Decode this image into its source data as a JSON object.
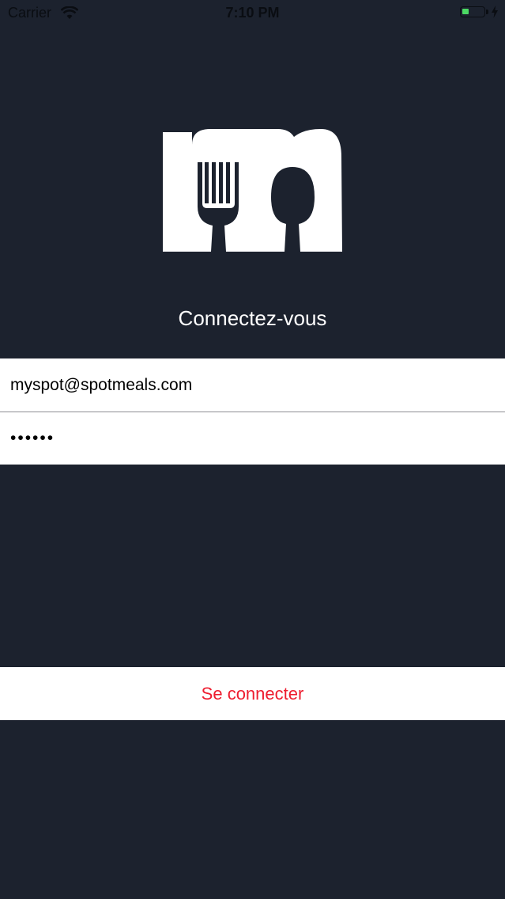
{
  "status_bar": {
    "carrier": "Carrier",
    "time": "7:10 PM",
    "battery_level": 0.3,
    "battery_charging": true,
    "battery_color": "#4cd964"
  },
  "logo": {
    "icon": "spotmeals-m-fork-spoon-logo"
  },
  "login": {
    "heading": "Connectez-vous",
    "email_value": "myspot@spotmeals.com",
    "password_value": "••••••",
    "submit_label": "Se connecter"
  },
  "colors": {
    "background": "#1c222e",
    "accent": "#ee1d2f",
    "field_background": "#ffffff"
  }
}
